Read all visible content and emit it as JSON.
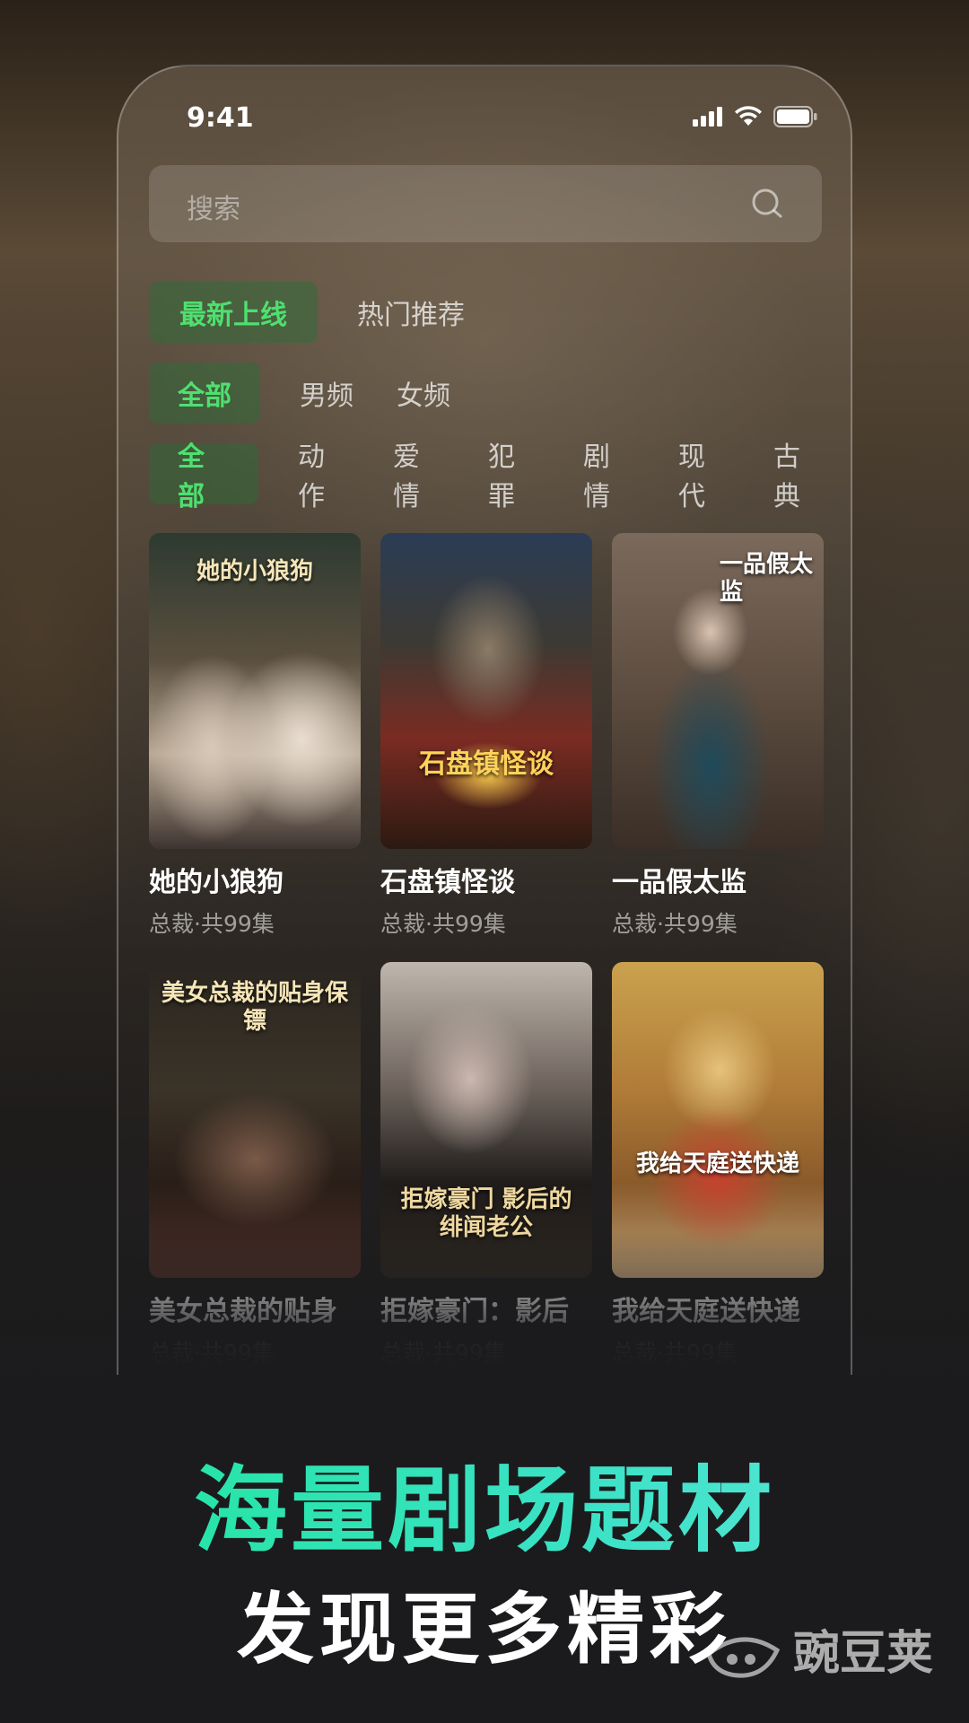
{
  "status_bar": {
    "time": "9:41"
  },
  "search": {
    "placeholder": "搜索"
  },
  "tabs_primary": [
    {
      "label": "最新上线",
      "active": true
    },
    {
      "label": "热门推荐",
      "active": false
    }
  ],
  "tabs_channel": [
    {
      "label": "全部",
      "active": true
    },
    {
      "label": "男频",
      "active": false
    },
    {
      "label": "女频",
      "active": false
    }
  ],
  "tabs_genre": [
    {
      "label": "全部",
      "active": true
    },
    {
      "label": "动作",
      "active": false
    },
    {
      "label": "爱情",
      "active": false
    },
    {
      "label": "犯罪",
      "active": false
    },
    {
      "label": "剧情",
      "active": false
    },
    {
      "label": "现代",
      "active": false
    },
    {
      "label": "古典",
      "active": false
    }
  ],
  "dramas": [
    {
      "title": "她的小狼狗",
      "subtitle": "总裁·共99集",
      "poster_text": "她的小狼狗"
    },
    {
      "title": "石盘镇怪谈",
      "subtitle": "总裁·共99集",
      "poster_text": "石盘镇怪谈"
    },
    {
      "title": "一品假太监",
      "subtitle": "总裁·共99集",
      "poster_text": "一品假太监"
    },
    {
      "title": "美女总裁的贴身",
      "subtitle": "总裁·共99集",
      "poster_text": "美女总裁的贴身保镖"
    },
    {
      "title": "拒嫁豪门：影后",
      "subtitle": "总裁·共99集",
      "poster_text": "拒嫁豪门 影后的绯闻老公"
    },
    {
      "title": "我给天庭送快递",
      "subtitle": "总裁·共99集",
      "poster_text": "我给天庭送快递"
    }
  ],
  "promo": {
    "headline": "海量剧场题材",
    "subline": "发现更多精彩",
    "watermark": "豌豆荚"
  },
  "colors": {
    "accent_green": "#4ee06f",
    "headline_gradient_start": "#1ee59a",
    "headline_gradient_end": "#5ee6d9"
  }
}
